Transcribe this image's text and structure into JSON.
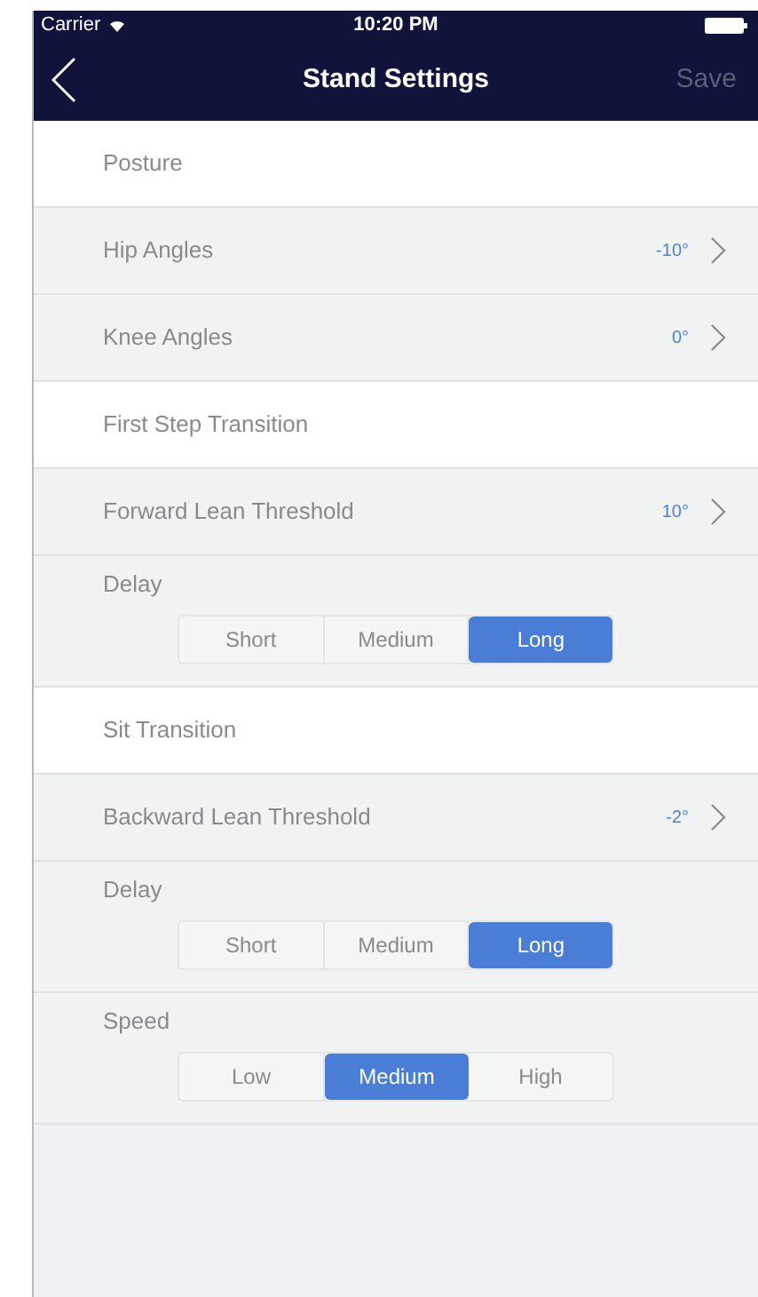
{
  "status_bar": {
    "carrier": "Carrier",
    "time": "10:20 PM"
  },
  "nav": {
    "title": "Stand Settings",
    "save": "Save",
    "save_disabled": true
  },
  "sections": [
    {
      "title": "Posture",
      "rows": [
        {
          "kind": "detail",
          "label": "Hip Angles",
          "value": "-10°"
        },
        {
          "kind": "detail",
          "label": "Knee Angles",
          "value": "0°"
        }
      ]
    },
    {
      "title": "First Step Transition",
      "rows": [
        {
          "kind": "detail",
          "label": "Forward Lean Threshold",
          "value": "10°"
        },
        {
          "kind": "segmented",
          "label": "Delay",
          "options": [
            {
              "label": "Short",
              "selected": false
            },
            {
              "label": "Medium",
              "selected": false
            },
            {
              "label": "Long",
              "selected": true
            }
          ]
        }
      ]
    },
    {
      "title": "Sit Transition",
      "rows": [
        {
          "kind": "detail",
          "label": "Backward Lean Threshold",
          "value": "-2°"
        },
        {
          "kind": "segmented",
          "label": "Delay",
          "options": [
            {
              "label": "Short",
              "selected": false
            },
            {
              "label": "Medium",
              "selected": false
            },
            {
              "label": "Long",
              "selected": true
            }
          ]
        },
        {
          "kind": "segmented",
          "label": "Speed",
          "options": [
            {
              "label": "Low",
              "selected": false
            },
            {
              "label": "Medium",
              "selected": true
            },
            {
              "label": "High",
              "selected": false
            }
          ]
        }
      ]
    }
  ]
}
